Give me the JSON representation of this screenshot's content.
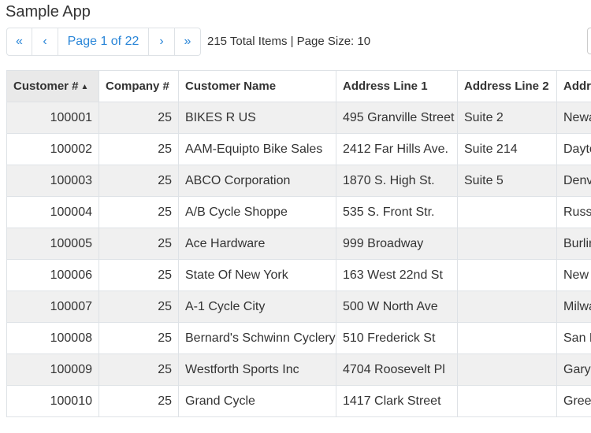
{
  "app": {
    "title": "Sample App"
  },
  "pager": {
    "first_icon": "«",
    "prev_icon": "‹",
    "page_label": "Page 1 of 22",
    "next_icon": "›",
    "last_icon": "»"
  },
  "summary": "215 Total Items | Page Size: 10",
  "columns": [
    "Customer #",
    "Company #",
    "Customer Name",
    "Address Line 1",
    "Address Line 2",
    "Address"
  ],
  "sort": {
    "column": "Customer #",
    "direction": "ascending",
    "indicator": "▲"
  },
  "rows": [
    [
      "100001",
      "25",
      "BIKES R US",
      "495 Granville Street",
      "Suite 2",
      "Newa"
    ],
    [
      "100002",
      "25",
      "AAM-Equipto Bike Sales",
      "2412 Far Hills Ave.",
      "Suite 214",
      "Dayto"
    ],
    [
      "100003",
      "25",
      "ABCO Corporation",
      "1870 S. High St.",
      "Suite 5",
      "Denv"
    ],
    [
      "100004",
      "25",
      "A/B Cycle Shoppe",
      "535 S. Front Str.",
      "",
      "Russe"
    ],
    [
      "100005",
      "25",
      "Ace Hardware",
      "999 Broadway",
      "",
      "Burlin"
    ],
    [
      "100006",
      "25",
      "State Of New York",
      "163 West 22nd St",
      "",
      "New"
    ],
    [
      "100007",
      "25",
      "A-1 Cycle City",
      "500 W North Ave",
      "",
      "Milwa"
    ],
    [
      "100008",
      "25",
      "Bernard's Schwinn Cyclery",
      "510 Frederick St",
      "",
      "San F"
    ],
    [
      "100009",
      "25",
      "Westforth Sports Inc",
      "4704 Roosevelt Pl",
      "",
      "Gary"
    ],
    [
      "100010",
      "25",
      "Grand Cycle",
      "1417 Clark Street",
      "",
      "Greer"
    ]
  ],
  "colors": {
    "link": "#2a86d8",
    "sorted_header_bg": "#e9e9e9",
    "stripe": "#f0f0f0"
  }
}
